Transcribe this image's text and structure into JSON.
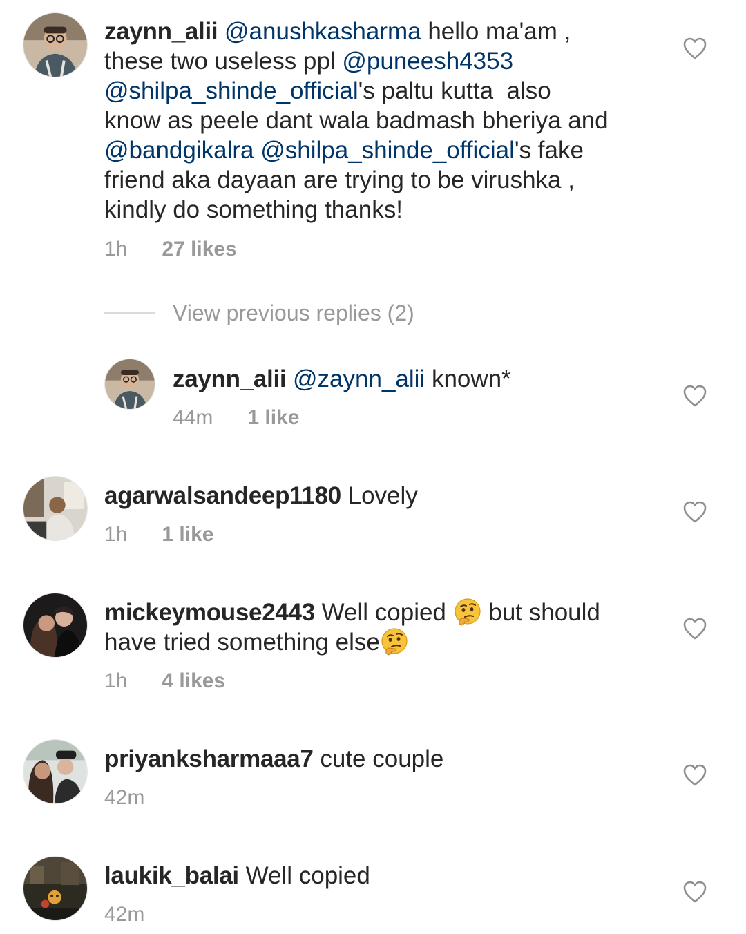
{
  "comments": [
    {
      "username": "zaynn_alii",
      "text_parts": [
        {
          "t": " "
        },
        {
          "t": "@anushkasharma",
          "m": true
        },
        {
          "t": " hello ma'am ,\nthese two useless ppl "
        },
        {
          "t": "@puneesh4353",
          "m": true
        },
        {
          "t": "\n"
        },
        {
          "t": "@shilpa_shinde_official",
          "m": true
        },
        {
          "t": "'s paltu kutta  also\nknow as peele dant wala badmash bheriya and\n"
        },
        {
          "t": "@bandgikalra",
          "m": true
        },
        {
          "t": " "
        },
        {
          "t": "@shilpa_shinde_official",
          "m": true
        },
        {
          "t": "'s fake\nfriend aka dayaan are trying to be virushka ,\nkindly do something thanks!"
        }
      ],
      "time": "1h",
      "likes": "27 likes",
      "avatar_icon": "avatar-glasses-man"
    },
    {
      "username": "zaynn_alii",
      "text_parts": [
        {
          "t": " "
        },
        {
          "t": "@zaynn_alii",
          "m": true
        },
        {
          "t": " known*"
        }
      ],
      "time": "44m",
      "likes": "1 like",
      "avatar_icon": "avatar-glasses-man"
    },
    {
      "username": "agarwalsandeep1180",
      "text_parts": [
        {
          "t": " Lovely"
        }
      ],
      "time": "1h",
      "likes": "1 like",
      "avatar_icon": "avatar-man-sofa"
    },
    {
      "username": "mickeymouse2443",
      "text_parts": [
        {
          "t": " Well copied "
        },
        {
          "emoji": "thinking-face-emoji"
        },
        {
          "t": " but should\nhave tried something else"
        },
        {
          "emoji": "thinking-face-emoji"
        }
      ],
      "time": "1h",
      "likes": "4 likes",
      "avatar_icon": "avatar-couple-dark"
    },
    {
      "username": "priyanksharmaaa7",
      "text_parts": [
        {
          "t": " cute couple"
        }
      ],
      "time": "42m",
      "likes": "",
      "avatar_icon": "avatar-couple-light"
    },
    {
      "username": "laukik_balai",
      "text_parts": [
        {
          "t": " Well copied"
        }
      ],
      "time": "42m",
      "likes": "",
      "avatar_icon": "avatar-dark-scene"
    }
  ],
  "view_previous_replies": "View previous replies (2)",
  "icons": {
    "like": "heart-outline-icon"
  },
  "colors": {
    "text": "#262626",
    "mention": "#003569",
    "meta": "#999999",
    "divider": "#dbdbdb"
  }
}
